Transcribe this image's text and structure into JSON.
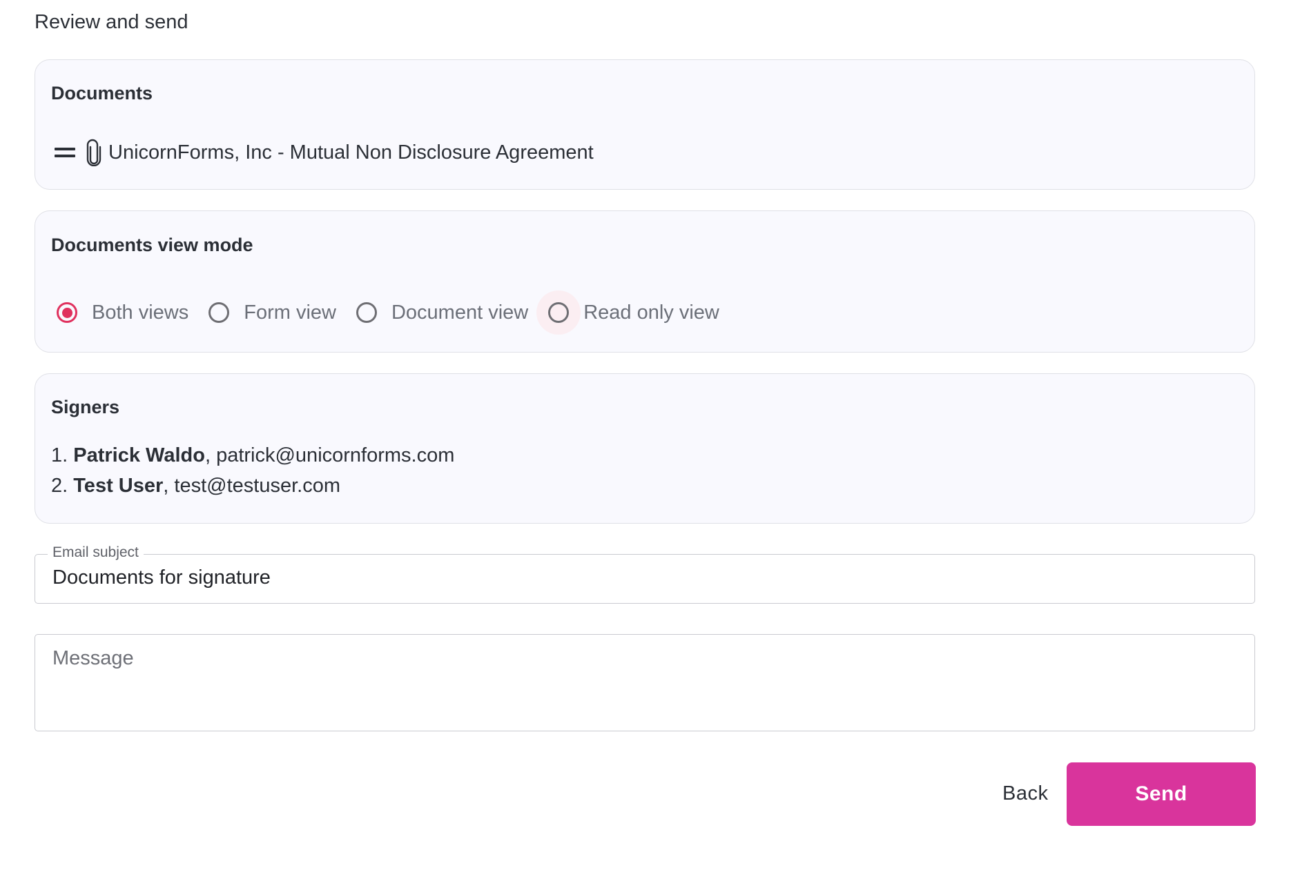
{
  "page": {
    "title": "Review and send"
  },
  "documents": {
    "title": "Documents",
    "items": [
      {
        "name": "UnicornForms, Inc - Mutual Non Disclosure Agreement",
        "icon": "paperclip-icon"
      }
    ]
  },
  "view_mode": {
    "title": "Documents view mode",
    "options": [
      {
        "label": "Both views",
        "checked": true
      },
      {
        "label": "Form view",
        "checked": false
      },
      {
        "label": "Document view",
        "checked": false
      },
      {
        "label": "Read only view",
        "checked": false,
        "focused": true
      }
    ],
    "accent_color": "#e0315e"
  },
  "signers": {
    "title": "Signers",
    "items": [
      {
        "index": "1.",
        "name": "Patrick Waldo",
        "email": "patrick@unicornforms.com"
      },
      {
        "index": "2.",
        "name": "Test User",
        "email": "test@testuser.com"
      }
    ]
  },
  "email_subject": {
    "label": "Email subject",
    "value": "Documents for signature"
  },
  "message": {
    "placeholder": "Message",
    "value": ""
  },
  "actions": {
    "back_label": "Back",
    "send_label": "Send",
    "send_color": "#d9349c"
  }
}
